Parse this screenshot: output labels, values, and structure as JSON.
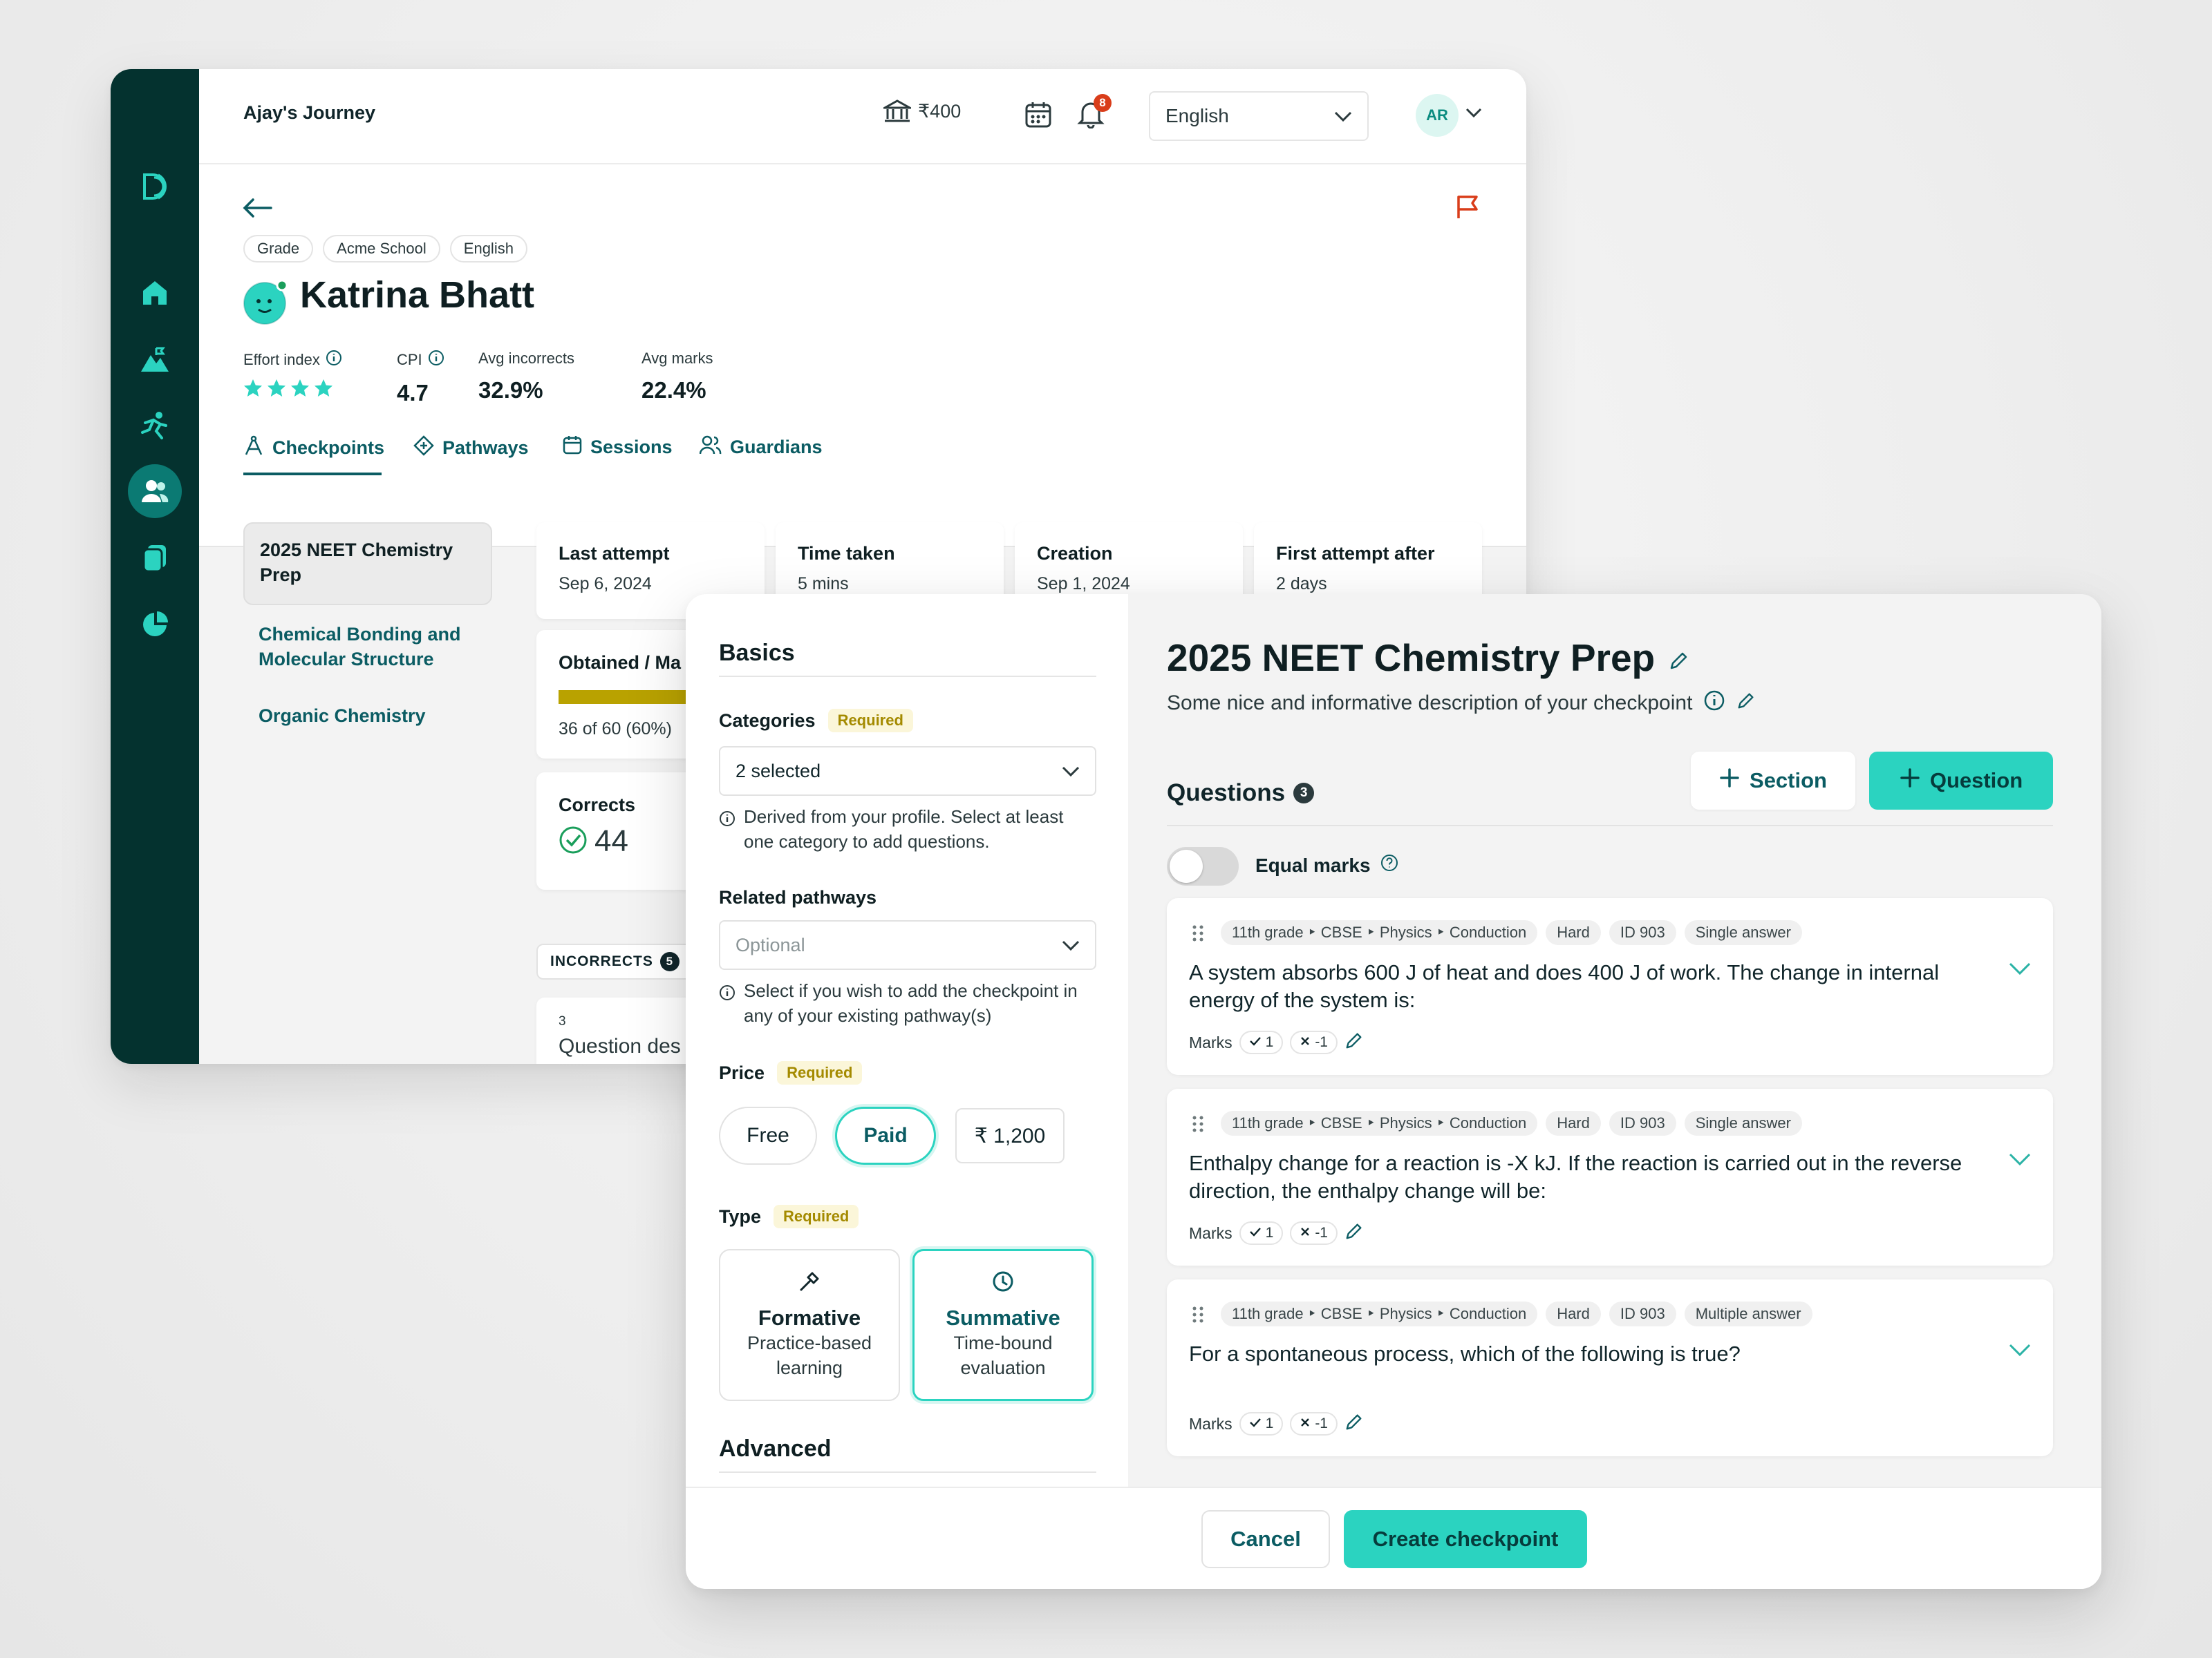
{
  "colors": {
    "brand_dark": "#04322f",
    "brand_teal": "#2bd3c0",
    "text_teal": "#0b5c63",
    "required_bg": "#fbf6d9",
    "required_text": "#a48a00",
    "progress": "#b9a200",
    "alert_red": "#d93d1a",
    "correct_green": "#1a9e5b"
  },
  "topbar": {
    "title": "Ajay's Journey",
    "balance": "₹400",
    "notification_count": "8",
    "language": "English",
    "avatar_initials": "AR"
  },
  "student": {
    "chips": [
      "Grade",
      "Acme School",
      "English"
    ],
    "name": "Katrina Bhatt",
    "effort_label": "Effort index",
    "effort_stars": 4,
    "cpi_label": "CPI",
    "cpi_value": "4.7",
    "avg_incorrects_label": "Avg incorrects",
    "avg_incorrects_value": "32.9%",
    "avg_marks_label": "Avg marks",
    "avg_marks_value": "22.4%"
  },
  "tabs": [
    "Checkpoints",
    "Pathways",
    "Sessions",
    "Guardians"
  ],
  "checkpoint_list": [
    "2025 NEET Chemistry Prep",
    "Chemical Bonding and Molecular Structure",
    "Organic Chemistry"
  ],
  "stats": {
    "last_attempt_label": "Last attempt",
    "last_attempt_value": "Sep 6, 2024",
    "time_taken_label": "Time taken",
    "time_taken_value": "5 mins",
    "creation_label": "Creation",
    "creation_value": "Sep 1, 2024",
    "first_attempt_label": "First attempt after",
    "first_attempt_value": "2 days",
    "obtained_label": "Obtained / Ma",
    "obtained_value": "36 of 60 (60%)",
    "obtained_fraction": 0.6,
    "corrects_label": "Corrects",
    "corrects_value": "44",
    "incorrects_label": "INCORRECTS",
    "incorrects_count": "5",
    "question_number": "3",
    "question_desc": "Question des"
  },
  "form": {
    "basics_title": "Basics",
    "categories_label": "Categories",
    "required_text": "Required",
    "categories_value": "2 selected",
    "categories_hint": "Derived from your profile. Select at least one category to add questions.",
    "pathways_label": "Related pathways",
    "pathways_placeholder": "Optional",
    "pathways_hint": "Select if you wish to add the checkpoint in any of your existing pathway(s)",
    "price_label": "Price",
    "price_free": "Free",
    "price_paid": "Paid",
    "price_amount": "₹ 1,200",
    "type_label": "Type",
    "formative_title": "Formative",
    "formative_desc": "Practice-based learning",
    "summative_title": "Summative",
    "summative_desc": "Time-bound evaluation",
    "advanced_title": "Advanced"
  },
  "checkpoint": {
    "title": "2025 NEET Chemistry Prep",
    "description": "Some nice and informative description of your checkpoint",
    "questions_label": "Questions",
    "questions_count": "3",
    "section_button": "Section",
    "question_button": "Question",
    "equal_marks_label": "Equal marks",
    "marks_label": "Marks",
    "positive_mark": "1",
    "negative_mark": "-1",
    "questions": [
      {
        "path": "11th grade ‣ CBSE ‣ Physics ‣ Conduction",
        "difficulty": "Hard",
        "id": "ID 903",
        "answer_type": "Single answer",
        "text": "A system absorbs 600 J of heat and does 400 J of work. The change in internal energy of the system is:"
      },
      {
        "path": "11th grade ‣ CBSE ‣ Physics ‣ Conduction",
        "difficulty": "Hard",
        "id": "ID 903",
        "answer_type": "Single answer",
        "text": "Enthalpy change for a reaction is -X kJ. If the reaction is carried out in the reverse direction, the enthalpy change will be:"
      },
      {
        "path": "11th grade ‣ CBSE ‣ Physics ‣ Conduction",
        "difficulty": "Hard",
        "id": "ID 903",
        "answer_type": "Multiple answer",
        "text": "For a spontaneous process, which of the following is true?"
      }
    ]
  },
  "footer": {
    "cancel": "Cancel",
    "create": "Create checkpoint"
  }
}
